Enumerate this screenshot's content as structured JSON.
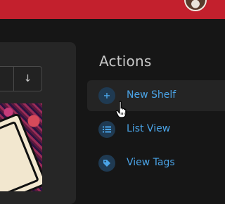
{
  "header": {
    "glyph": "˙"
  },
  "colors": {
    "header_bg": "#c3202d",
    "page_bg": "#161616",
    "panel_bg": "#262626",
    "accent": "#4aa3e6",
    "icon_circle": "#1f3a52"
  },
  "toolbar": {
    "sort_icon": "arrow-down-icon",
    "sort_glyph": "↓"
  },
  "actions": {
    "title": "Actions",
    "items": [
      {
        "label": "New Shelf",
        "icon": "plus-icon"
      },
      {
        "label": "List View",
        "icon": "list-icon"
      },
      {
        "label": "View Tags",
        "icon": "tag-icon"
      }
    ]
  }
}
